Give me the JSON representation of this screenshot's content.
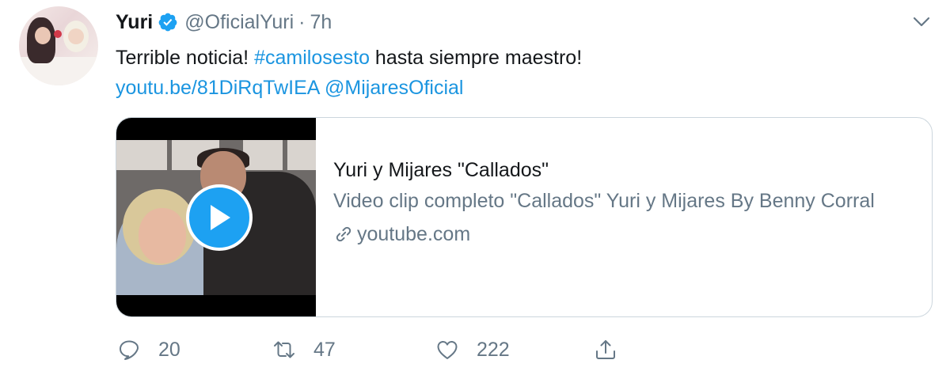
{
  "tweet": {
    "display_name": "Yuri",
    "handle": "@OficialYuri",
    "separator": "·",
    "time": "7h",
    "text_part1": "Terrible noticia! ",
    "hashtag": "#camilosesto",
    "text_part2": " hasta siempre maestro!",
    "link_url": "youtu.be/81DiRqTwIEA",
    "mention": "@MijaresOficial"
  },
  "card": {
    "title": "Yuri y Mijares \"Callados\"",
    "description": "Video clip completo \"Callados\" Yuri y Mijares By Benny Corral",
    "domain": "youtube.com"
  },
  "actions": {
    "replies": "20",
    "retweets": "47",
    "likes": "222"
  },
  "icons": {
    "verified": "verified-badge-icon",
    "menu": "chevron-down-icon",
    "play": "play-icon",
    "link": "link-icon",
    "reply": "reply-icon",
    "retweet": "retweet-icon",
    "like": "heart-icon",
    "share": "share-icon"
  },
  "colors": {
    "link": "#1b95e0",
    "verified": "#1da1f2",
    "secondary_text": "#657786",
    "card_border": "#ccd6dd"
  }
}
